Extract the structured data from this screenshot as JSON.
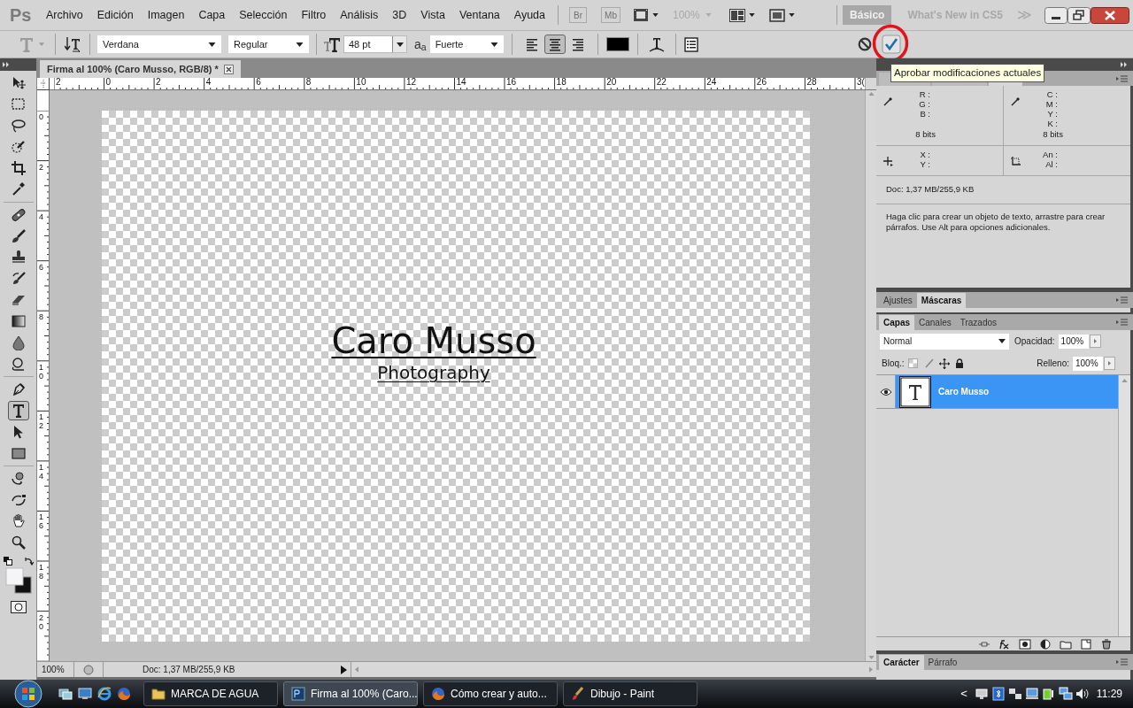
{
  "app_logo": "Ps",
  "menu": [
    "Archivo",
    "Edición",
    "Imagen",
    "Capa",
    "Selección",
    "Filtro",
    "Análisis",
    "3D",
    "Vista",
    "Ventana",
    "Ayuda"
  ],
  "app_bar": {
    "bridge": "Br",
    "mini_bridge": "Mb",
    "zoom": "100%",
    "more": "≫",
    "workspaces": [
      {
        "label": "Básico",
        "selected": true
      },
      {
        "label": "What's New in CS5",
        "selected": false
      }
    ]
  },
  "options_bar": {
    "font_family": "Verdana",
    "font_style": "Regular",
    "font_size": "48 pt",
    "antialias_icon": "a$_{a}$",
    "antialias": "Fuerte",
    "align": [
      {
        "kind": "left",
        "selected": false
      },
      {
        "kind": "center",
        "selected": true
      },
      {
        "kind": "right",
        "selected": false
      }
    ]
  },
  "tooltip": "Aprobar modificaciones actuales",
  "tools": [
    {
      "kind": "move",
      "selected": false
    },
    {
      "kind": "marquee",
      "selected": false
    },
    {
      "kind": "lasso",
      "selected": false
    },
    {
      "kind": "quick-select",
      "selected": false
    },
    {
      "kind": "crop",
      "selected": false
    },
    {
      "kind": "eyedropper",
      "selected": false
    },
    {
      "kind": "healing",
      "selected": false
    },
    {
      "kind": "brush",
      "selected": false
    },
    {
      "kind": "stamp",
      "selected": false
    },
    {
      "kind": "history-brush",
      "selected": false
    },
    {
      "kind": "eraser",
      "selected": false
    },
    {
      "kind": "gradient",
      "selected": false
    },
    {
      "kind": "blur",
      "selected": false
    },
    {
      "kind": "dodge",
      "selected": false
    },
    {
      "kind": "pen",
      "selected": false
    },
    {
      "kind": "type",
      "selected": true
    },
    {
      "kind": "path-select",
      "selected": false
    },
    {
      "kind": "shape",
      "selected": false
    },
    {
      "kind": "rotate3d",
      "selected": false
    },
    {
      "kind": "orbit3d",
      "selected": false
    },
    {
      "kind": "hand",
      "selected": false
    },
    {
      "kind": "zoom",
      "selected": false
    }
  ],
  "document": {
    "tab": "Firma al 100% (Caro Musso, RGB/8) *",
    "ruler_h": [
      "2",
      "0",
      "2",
      "4",
      "6",
      "8",
      "10",
      "12",
      "14",
      "16",
      "18",
      "20",
      "22",
      "24",
      "26",
      "28",
      "3("
    ],
    "ruler_v": [
      "0",
      "2",
      "4",
      "6",
      "8",
      "10",
      "12",
      "14",
      "16",
      "18",
      "20"
    ],
    "title_text": "Caro Musso",
    "subtitle_text": "Photography",
    "zoom": "100%",
    "status": "Doc: 1,37 MB/255,9 KB"
  },
  "info_tabs": [
    {
      "selected": false
    },
    {
      "selected": false
    },
    {
      "selected": true
    }
  ],
  "info_panel": {
    "rgb_labels": [
      "R :",
      "G :",
      "B :"
    ],
    "rgb_bits": "8 bits",
    "cmyk_labels": [
      "C :",
      "M :",
      "Y :",
      "K :"
    ],
    "cmyk_bits": "8 bits",
    "xy_labels": [
      "X :",
      "Y :"
    ],
    "size_labels": [
      "An :",
      "Al :"
    ],
    "doc": "Doc: 1,37 MB/255,9 KB",
    "hint": "Haga clic para crear un objeto de texto, arrastre para crear párrafos. Use Alt para opciones adicionales."
  },
  "adjust_tabs": [
    {
      "label": "Ajustes",
      "selected": false
    },
    {
      "label": "Máscaras",
      "selected": true
    }
  ],
  "layer_tabs": [
    {
      "label": "Capas",
      "selected": true
    },
    {
      "label": "Canales",
      "selected": false
    },
    {
      "label": "Trazados",
      "selected": false
    }
  ],
  "layers_panel": {
    "blend_mode": "Normal",
    "opacity_label": "Opacidad:",
    "opacity": "100%",
    "lock_label": "Bloq.:",
    "fill_label": "Relleno:",
    "fill": "100%"
  },
  "layers": [
    {
      "name": "Caro Musso",
      "kind": "text",
      "visible": true,
      "selected": true
    }
  ],
  "char_tabs": [
    {
      "label": "Carácter",
      "selected": true
    },
    {
      "label": "Párrafo",
      "selected": false
    }
  ],
  "taskbar": {
    "tasks": [
      {
        "label": "MARCA DE AGUA",
        "kind": "folder",
        "selected": false
      },
      {
        "label": "Firma al 100% (Caro...",
        "kind": "photoshop",
        "selected": true
      },
      {
        "label": "Cómo crear y auto...",
        "kind": "firefox",
        "selected": false
      },
      {
        "label": "Dibujo - Paint",
        "kind": "paint",
        "selected": false
      }
    ],
    "tray_arrow": "<",
    "time": "11:29"
  }
}
